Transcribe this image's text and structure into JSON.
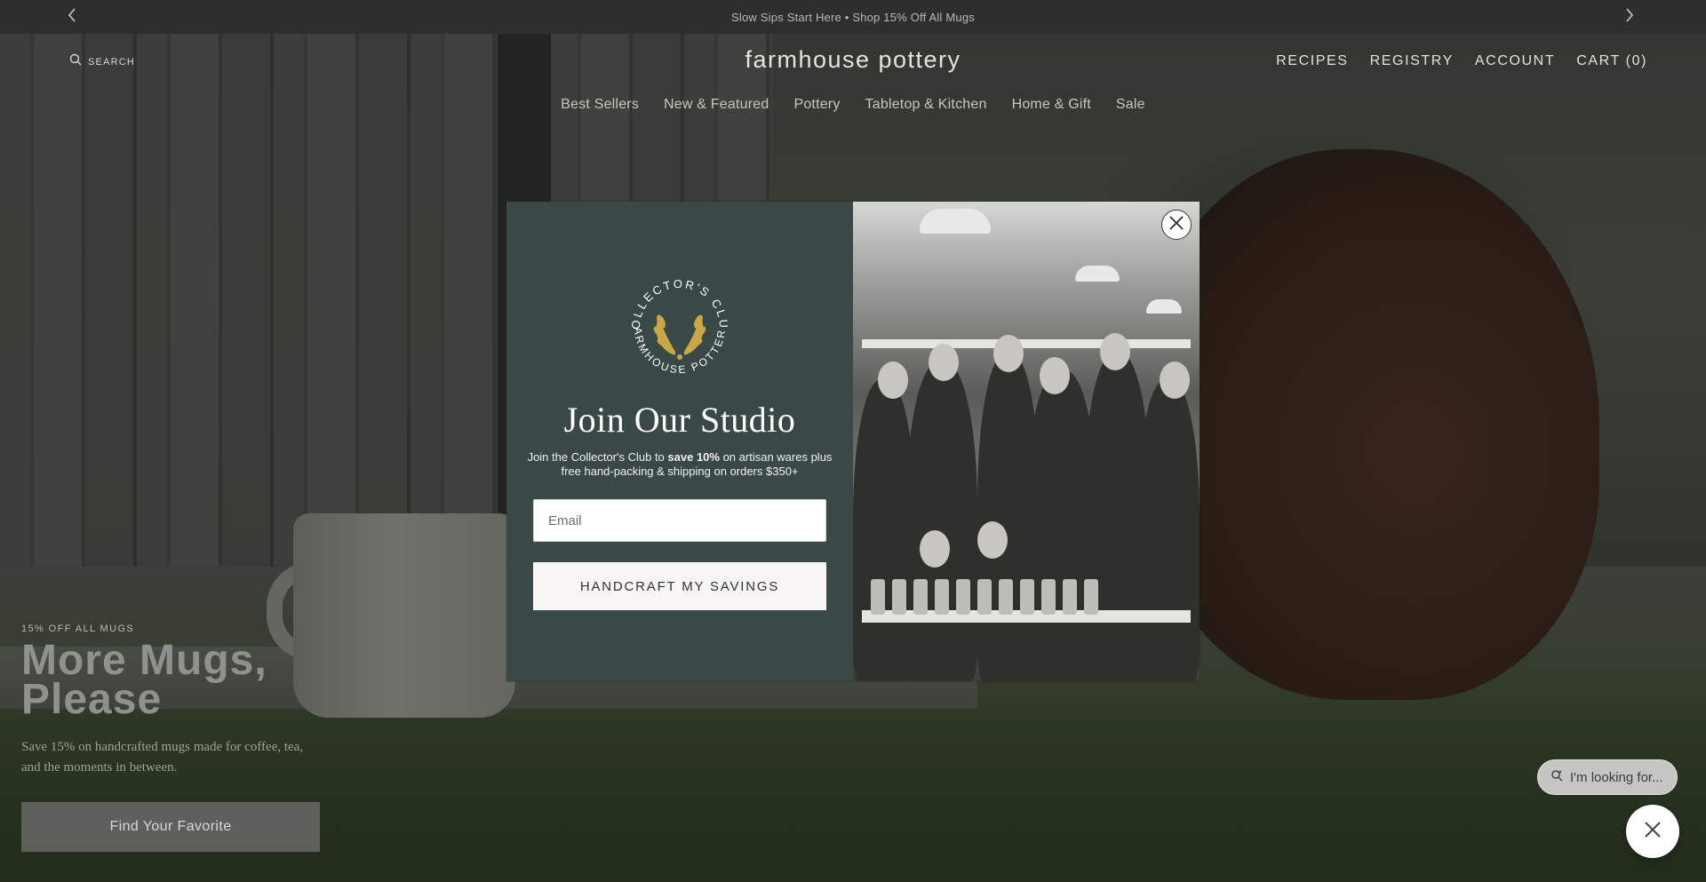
{
  "announcement": {
    "text": "Slow Sips Start Here • Shop 15% Off All Mugs",
    "prev_icon": "chevron-left-icon",
    "next_icon": "chevron-right-icon"
  },
  "header": {
    "search_label": "SEARCH",
    "logo": "farmhouse pottery",
    "utility": {
      "recipes": "RECIPES",
      "registry": "REGISTRY",
      "account": "ACCOUNT",
      "cart": "CART (0)"
    },
    "nav": {
      "best_sellers": "Best Sellers",
      "new_featured": "New & Featured",
      "pottery": "Pottery",
      "tabletop": "Tabletop & Kitchen",
      "home_gift": "Home & Gift",
      "sale": "Sale"
    }
  },
  "hero": {
    "eyebrow": "15% OFF ALL MUGS",
    "headline_line1": "More Mugs,",
    "headline_line2": "Please",
    "subtext": "Save 15% on handcrafted mugs made for coffee, tea, and the moments in between.",
    "cta": "Find Your Favorite"
  },
  "modal": {
    "badge_top": "COLLECTOR'S CLUB",
    "badge_bottom": "FARMHOUSE POTTERY",
    "title": "Join Our Studio",
    "body_pre": "Join the Collector's Club to ",
    "body_bold": "save 10%",
    "body_post": " on artisan wares plus free hand-packing & shipping on orders $350+",
    "email_placeholder": "Email",
    "submit_label": "HANDCRAFT MY SAVINGS"
  },
  "chat": {
    "looking_label": "I'm looking for..."
  },
  "colors": {
    "modal_panel": "#3a4846",
    "announcement_bg": "#2d2f2d",
    "cta_bg": "#5f605c"
  }
}
